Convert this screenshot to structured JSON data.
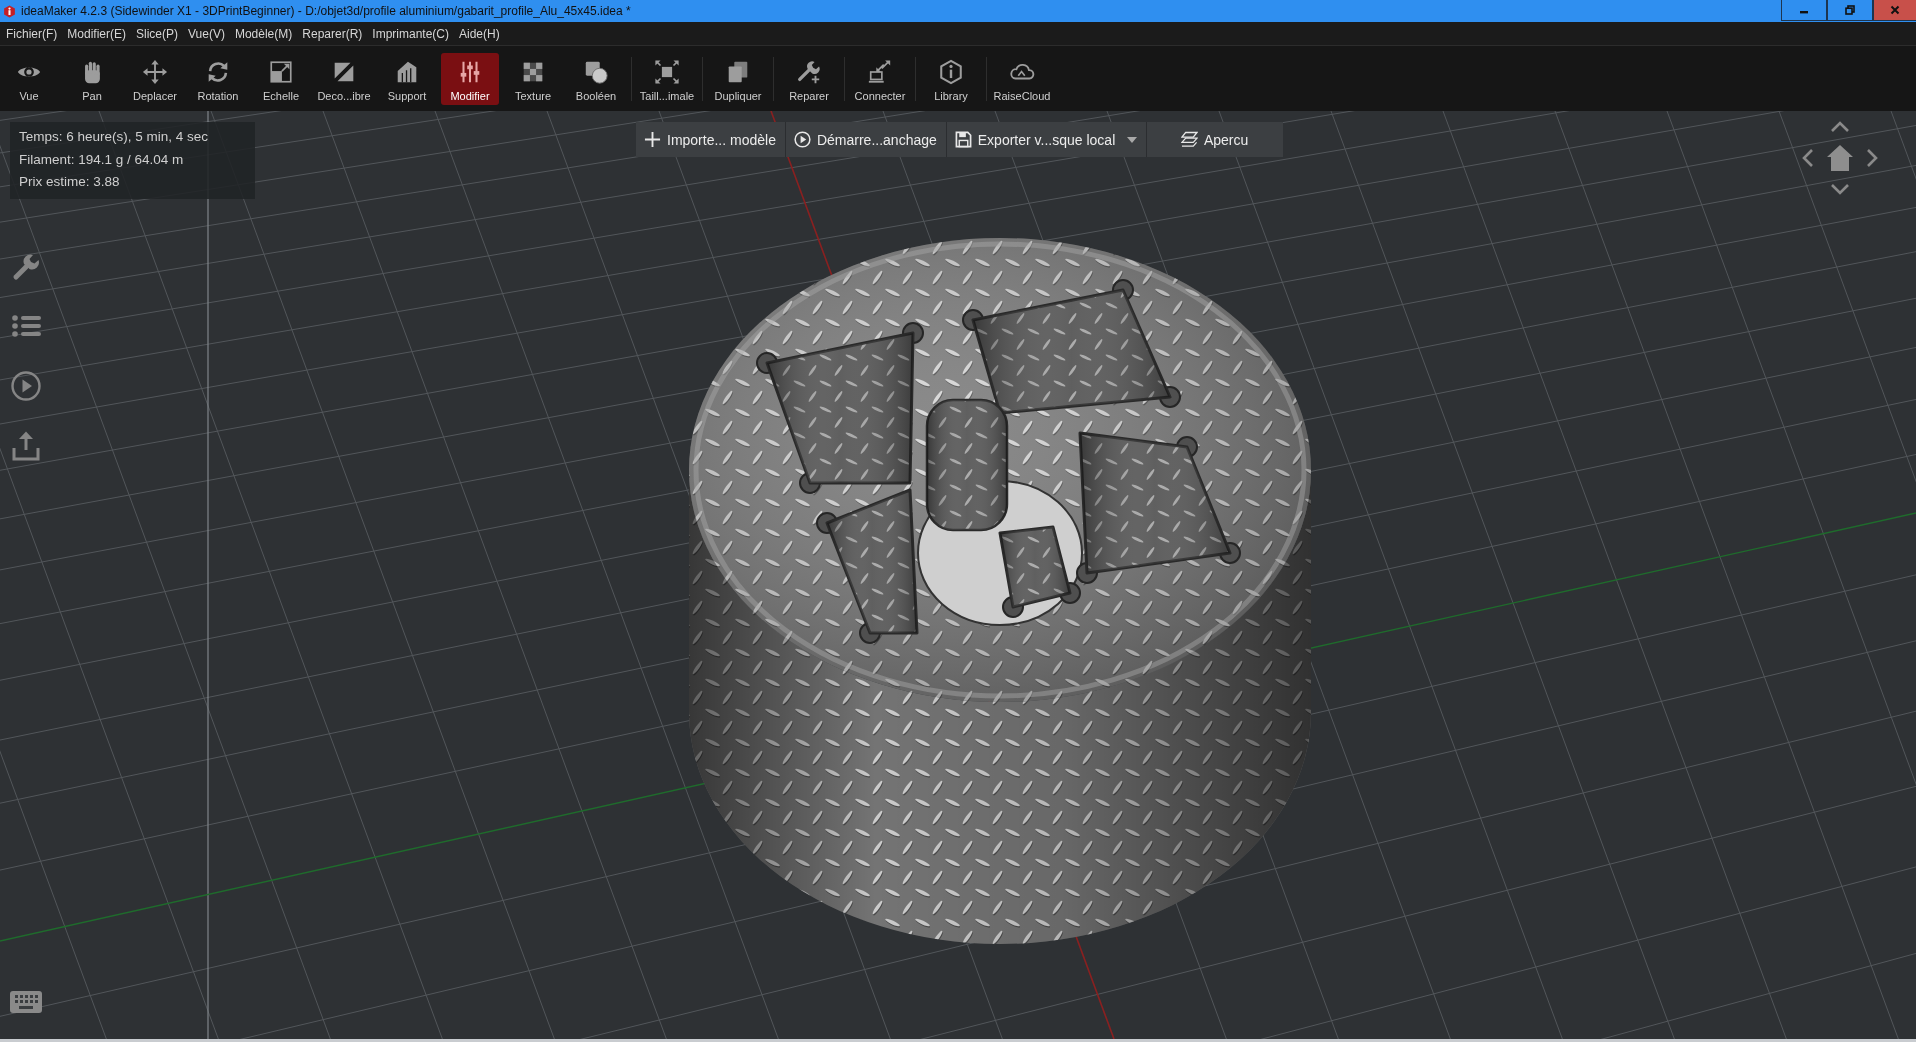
{
  "window": {
    "title": "ideaMaker 4.2.3 (Sidewinder X1 - 3DPrintBeginner) - D:/objet3d/profile aluminium/gabarit_profile_Alu_45x45.idea *"
  },
  "menu": [
    "Fichier(F)",
    "Modifier(E)",
    "Slice(P)",
    "Vue(V)",
    "Modèle(M)",
    "Reparer(R)",
    "Imprimante(C)",
    "Aide(H)"
  ],
  "toolbar": {
    "groups": [
      {
        "items": [
          {
            "label": "Vue",
            "selected": false
          },
          {
            "label": "Pan",
            "selected": false
          },
          {
            "label": "Deplacer",
            "selected": false
          },
          {
            "label": "Rotation",
            "selected": false
          },
          {
            "label": "Echelle",
            "selected": false
          },
          {
            "label": "Deco...ibre",
            "selected": false
          },
          {
            "label": "Support",
            "selected": false
          },
          {
            "label": "Modifier",
            "selected": true
          },
          {
            "label": "Texture",
            "selected": false
          },
          {
            "label": "Booléen",
            "selected": false
          }
        ]
      },
      {
        "items": [
          {
            "label": "Taill...imale",
            "selected": false
          }
        ]
      },
      {
        "items": [
          {
            "label": "Dupliquer",
            "selected": false
          }
        ]
      },
      {
        "items": [
          {
            "label": "Reparer",
            "selected": false
          }
        ]
      },
      {
        "items": [
          {
            "label": "Connecter",
            "selected": false
          }
        ]
      },
      {
        "items": [
          {
            "label": "Library",
            "selected": false
          }
        ]
      },
      {
        "items": [
          {
            "label": "RaiseCloud",
            "selected": false
          }
        ]
      }
    ]
  },
  "info_panel": {
    "lines": [
      "Temps: 6 heure(s), 5 min, 4 sec",
      "Filament: 194.1 g / 64.04 m",
      "Prix estime: 3.88"
    ]
  },
  "action_bar": {
    "buttons": [
      {
        "label": "Importe... modèle",
        "dropdown": false
      },
      {
        "label": "Démarre...anchage",
        "dropdown": false
      },
      {
        "label": "Exporter v...sque local",
        "dropdown": true
      },
      {
        "label": "Apercu",
        "dropdown": false
      }
    ]
  }
}
